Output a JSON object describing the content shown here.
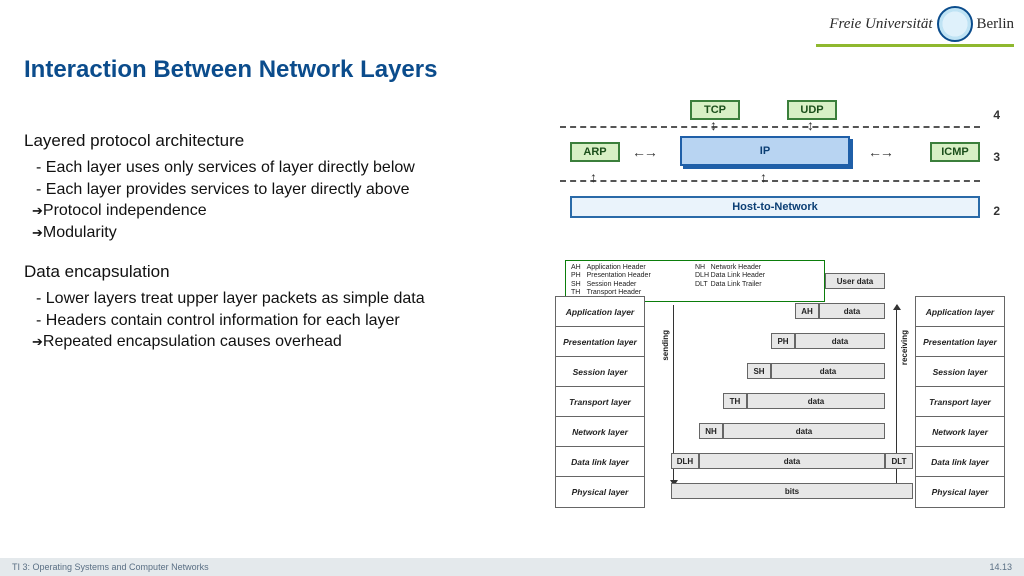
{
  "header": {
    "logo_left": "Freie Universität",
    "logo_right": "Berlin"
  },
  "title": "Interaction Between Network Layers",
  "body": {
    "sec1_h": "Layered protocol architecture",
    "sec1_b1": "Each layer uses only services of layer directly below",
    "sec1_b2": "Each layer provides services to layer directly above",
    "sec1_a1": "Protocol independence",
    "sec1_a2": "Modularity",
    "sec2_h": "Data encapsulation",
    "sec2_b1": "Lower layers treat upper layer packets as simple data",
    "sec2_b2": "Headers contain control information for each layer",
    "sec2_a1": "Repeated encapsulation causes overhead"
  },
  "net": {
    "tcp": "TCP",
    "udp": "UDP",
    "arp": "ARP",
    "ip": "IP",
    "icmp": "ICMP",
    "h2n": "Host-to-Network",
    "l4": "4",
    "l3": "3",
    "l2": "2"
  },
  "enc": {
    "legend": {
      "c1": "AH\tApplication Header\nPH\tPresentation Header\nSH\tSession Header\nTH\tTransport Header",
      "c2": "NH\tNetwork Header\nDLH\tData Link Header\nDLT\tData Link Trailer"
    },
    "layers": [
      "Application layer",
      "Presentation layer",
      "Session layer",
      "Transport layer",
      "Network layer",
      "Data link layer",
      "Physical layer"
    ],
    "userdata": "User data",
    "data": "data",
    "bits": "bits",
    "ah": "AH",
    "ph": "PH",
    "sh": "SH",
    "th": "TH",
    "nh": "NH",
    "dlh": "DLH",
    "dlt": "DLT",
    "sending": "sending",
    "receiving": "receiving"
  },
  "footer": {
    "left": "TI 3: Operating Systems and Computer Networks",
    "right": "14.13"
  }
}
